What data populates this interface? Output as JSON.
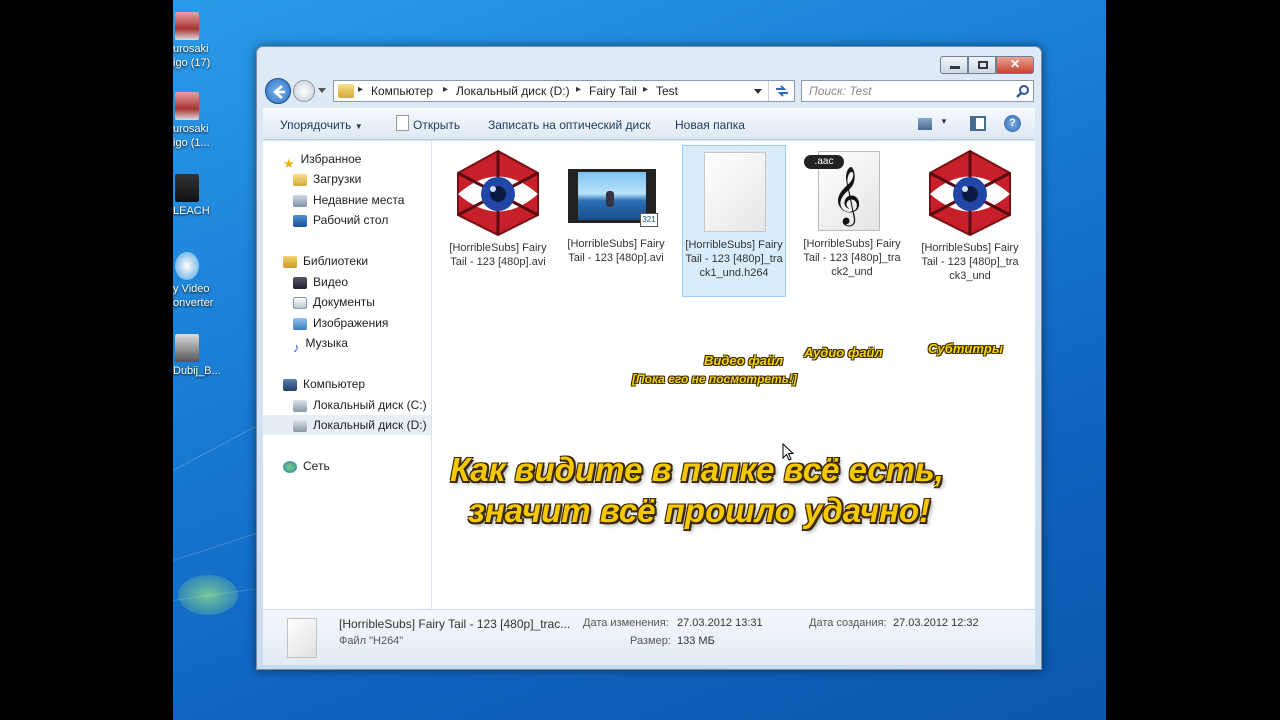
{
  "desktop": {
    "icons": [
      {
        "label": "urosaki\nigo (17)"
      },
      {
        "label": "urosaki\nigo (1..."
      },
      {
        "label": "LEACH"
      },
      {
        "label": "y Video\nonverter"
      },
      {
        "label": "Dubij_B..."
      }
    ]
  },
  "window": {
    "controls": {
      "minimize": "—",
      "maximize": "□",
      "close": "✕"
    },
    "address": {
      "segments": [
        "Компьютер",
        "Локальный диск (D:)",
        "Fairy Tail",
        "Test"
      ]
    },
    "search": {
      "placeholder": "Поиск: Test"
    },
    "toolbar": {
      "organize": "Упорядочить",
      "open": "Открыть",
      "burn": "Записать на оптический диск",
      "new_folder": "Новая папка"
    },
    "nav": {
      "favorites": "Избранное",
      "downloads": "Загрузки",
      "recent": "Недавние места",
      "desktop": "Рабочий стол",
      "libraries": "Библиотеки",
      "video": "Видео",
      "documents": "Документы",
      "pictures": "Изображения",
      "music": "Музыка",
      "computer": "Компьютер",
      "disk_c": "Локальный диск (C:)",
      "disk_d": "Локальный диск (D:)",
      "network": "Сеть"
    },
    "files": [
      {
        "name": "[HorribleSubs] Fairy Tail - 123 [480p].avi",
        "icon": "aegisub-eye-icon"
      },
      {
        "name": "[HorribleSubs] Fairy Tail - 123 [480p].avi",
        "icon": "video-thumbnail-icon"
      },
      {
        "name": "[HorribleSubs] Fairy Tail - 123 [480p]_track1_und.h264",
        "icon": "blank-file-icon"
      },
      {
        "name": "[HorribleSubs] Fairy Tail - 123 [480p]_track2_und",
        "icon": "aac-audio-icon"
      },
      {
        "name": "[HorribleSubs] Fairy Tail - 123 [480p]_track3_und",
        "icon": "aegisub-eye-icon"
      }
    ],
    "annotations": {
      "video_label": "Видео файл",
      "video_note": "[Пока его не посмотреть!]",
      "audio_label": "Аудио файл",
      "subs_label": "Субтитры",
      "main_line1": "Как видите в папке всё есть,",
      "main_line2": "значит всё прошло удачно!"
    },
    "details": {
      "filename": "[HorribleSubs] Fairy Tail - 123 [480p]_trac...",
      "type": "Файл \"H264\"",
      "modified_label": "Дата изменения:",
      "modified_value": "27.03.2012 13:31",
      "created_label": "Дата создания:",
      "created_value": "27.03.2012 12:32",
      "size_label": "Размер:",
      "size_value": "133 МБ"
    }
  },
  "colors": {
    "annotation": "#f6c800",
    "desktop": "#1a7fd6",
    "selection": "#cce8ff"
  }
}
